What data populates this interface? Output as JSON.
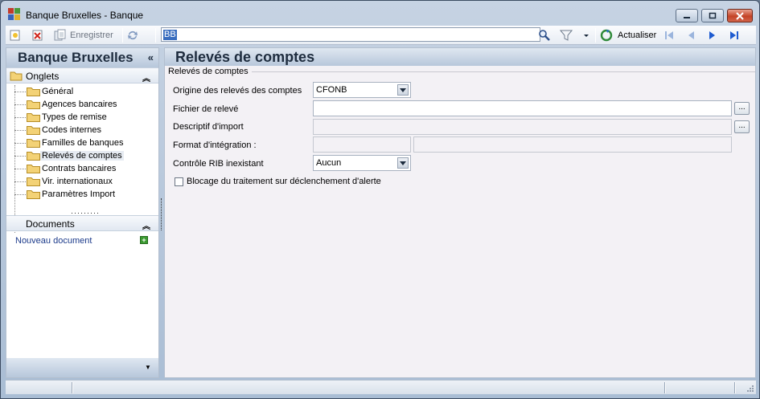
{
  "window": {
    "title": "Banque Bruxelles -  Banque"
  },
  "toolbar": {
    "save_label": "Enregistrer",
    "search_value": "BB",
    "refresh_label": "Actualiser"
  },
  "left": {
    "header": "Banque Bruxelles",
    "collapse_glyph": "«",
    "onglets_title": "Onglets",
    "onglets": [
      "Général",
      "Agences bancaires",
      "Types de remise",
      "Codes internes",
      "Familles de banques",
      "Relevés de comptes",
      "Contrats bancaires",
      "Vir. internationaux",
      "Paramètres Import"
    ],
    "selected_index": 5,
    "documents_title": "Documents",
    "new_document": "Nouveau document",
    "plus_glyph": "+"
  },
  "main": {
    "title": "Relevés de comptes",
    "group_title": "Relevés de comptes",
    "fields": {
      "origin_label": "Origine des relevés des comptes",
      "origin_value": "CFONB",
      "file_label": "Fichier de relevé",
      "file_value": "",
      "import_desc_label": "Descriptif d'import",
      "format_label": "Format d'intégration :",
      "rib_label": "Contrôle RIB inexistant",
      "rib_value": "Aucun",
      "block_label": "Blocage du traitement sur déclenchement d'alerte",
      "block_checked": false,
      "dots": "..."
    }
  },
  "colors": {
    "accent": "#3a6ebf",
    "header_text": "#1e2c3e",
    "link": "#1b3a8a",
    "close_button": "#c44327"
  }
}
